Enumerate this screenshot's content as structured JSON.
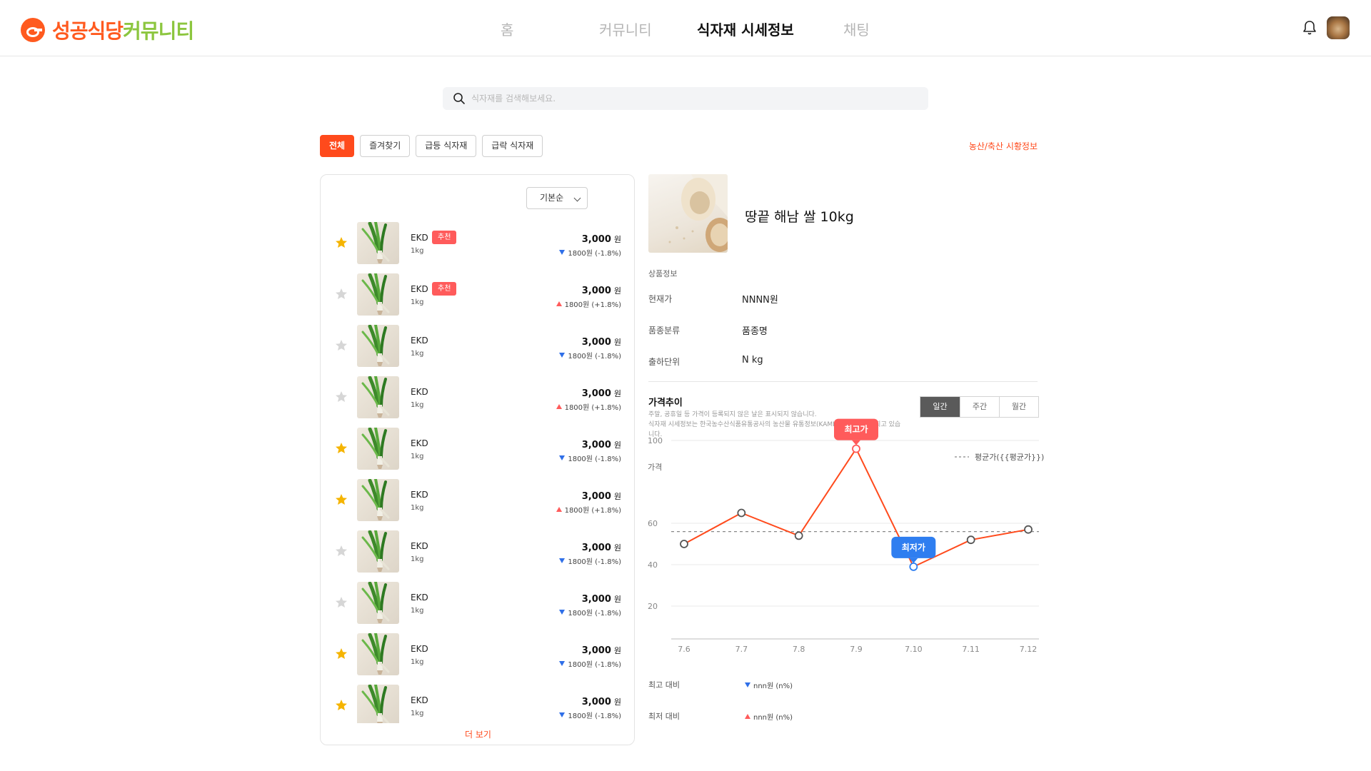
{
  "header": {
    "logo_main": "성공식당",
    "logo_accent": "커뮤니티",
    "nav": [
      {
        "label": "홈",
        "active": false
      },
      {
        "label": "커뮤니티",
        "active": false
      },
      {
        "label": "식자재 시세정보",
        "active": true
      },
      {
        "label": "채팅",
        "active": false
      }
    ]
  },
  "search": {
    "placeholder": "식자재를 검색해보세요."
  },
  "filters": [
    {
      "label": "전체",
      "active": true
    },
    {
      "label": "즐겨찾기",
      "active": false
    },
    {
      "label": "급등 식자재",
      "active": false
    },
    {
      "label": "급락 식자재",
      "active": false
    }
  ],
  "market_link": "농산/축산 시황정보",
  "list": {
    "sort_label": "기본순",
    "more_label": "더 보기",
    "items": [
      {
        "name": "EKD",
        "badge": "추천",
        "unit": "1kg",
        "price": "3,000",
        "won": "원",
        "direction": "down",
        "change": "1800원 (-1.8%)",
        "favorite": true
      },
      {
        "name": "EKD",
        "badge": "추천",
        "unit": "1kg",
        "price": "3,000",
        "won": "원",
        "direction": "up",
        "change": "1800원 (+1.8%)",
        "favorite": false
      },
      {
        "name": "EKD",
        "badge": "",
        "unit": "1kg",
        "price": "3,000",
        "won": "원",
        "direction": "down",
        "change": "1800원 (-1.8%)",
        "favorite": false
      },
      {
        "name": "EKD",
        "badge": "",
        "unit": "1kg",
        "price": "3,000",
        "won": "원",
        "direction": "up",
        "change": "1800원 (+1.8%)",
        "favorite": false
      },
      {
        "name": "EKD",
        "badge": "",
        "unit": "1kg",
        "price": "3,000",
        "won": "원",
        "direction": "down",
        "change": "1800원 (-1.8%)",
        "favorite": true
      },
      {
        "name": "EKD",
        "badge": "",
        "unit": "1kg",
        "price": "3,000",
        "won": "원",
        "direction": "up",
        "change": "1800원 (+1.8%)",
        "favorite": true
      },
      {
        "name": "EKD",
        "badge": "",
        "unit": "1kg",
        "price": "3,000",
        "won": "원",
        "direction": "down",
        "change": "1800원 (-1.8%)",
        "favorite": false
      },
      {
        "name": "EKD",
        "badge": "",
        "unit": "1kg",
        "price": "3,000",
        "won": "원",
        "direction": "down",
        "change": "1800원 (-1.8%)",
        "favorite": false
      },
      {
        "name": "EKD",
        "badge": "",
        "unit": "1kg",
        "price": "3,000",
        "won": "원",
        "direction": "down",
        "change": "1800원 (-1.8%)",
        "favorite": true
      },
      {
        "name": "EKD",
        "badge": "",
        "unit": "1kg",
        "price": "3,000",
        "won": "원",
        "direction": "down",
        "change": "1800원 (-1.8%)",
        "favorite": true
      }
    ]
  },
  "detail": {
    "title": "땅끝 해남 쌀 10kg",
    "section_label": "상품정보",
    "rows": [
      {
        "label": "현재가",
        "value": "NNNN원"
      },
      {
        "label": "품종분류",
        "value": "품종명"
      },
      {
        "label": "출하단위",
        "value": "N kg"
      }
    ]
  },
  "trend": {
    "title": "가격추이",
    "note": "주말, 공휴일 등 가격이 등록되지 않은 날은 표시되지 않습니다.\n식자재 시세정보는 한국농수산식품유통공사의 농산물 유통정보(KAMIS)를 통해 제공되고 있습니다.",
    "periods": [
      {
        "label": "일간",
        "active": true
      },
      {
        "label": "주간",
        "active": false
      },
      {
        "label": "월간",
        "active": false
      }
    ],
    "comparisons": [
      {
        "label": "최고 대비",
        "direction": "down",
        "value": "nnn원 (n%)"
      },
      {
        "label": "최저 대비",
        "direction": "up",
        "value": "nnn원 (n%)"
      }
    ]
  },
  "chart_data": {
    "type": "line",
    "ylabel": "가격",
    "ylim": [
      0,
      100
    ],
    "yticks": [
      {
        "value": 20,
        "label": "20"
      },
      {
        "value": 40,
        "label": "40"
      },
      {
        "value": 60,
        "label": "60"
      },
      {
        "value": 100,
        "label": "100"
      }
    ],
    "categories": [
      "7.6",
      "7.7",
      "7.8",
      "7.9",
      "7.10",
      "7.11",
      "7.12"
    ],
    "values": [
      50,
      65,
      54,
      96,
      39,
      52,
      57
    ],
    "average": {
      "label": "평균가({{평균가}})",
      "value": 56
    },
    "max_label": "최고가",
    "min_label": "최저가",
    "colors": {
      "line": "#ff4a1c",
      "max": "#ff5b5b",
      "min": "#2f7ef0",
      "avg": "#888888"
    },
    "grid": true
  }
}
